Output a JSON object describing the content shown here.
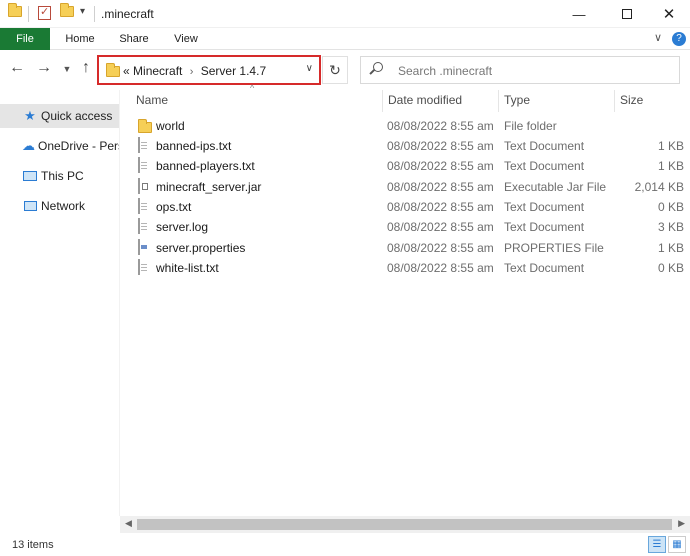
{
  "window": {
    "title": ".minecraft",
    "minimize_icon": "minimize-icon",
    "maximize_icon": "maximize-icon",
    "close_icon": "close-icon"
  },
  "ribbon": {
    "tabs": [
      "File",
      "Home",
      "Share",
      "View"
    ]
  },
  "navigation": {
    "address": {
      "prefix": "«",
      "segments": [
        "Minecraft",
        "Server 1.4.7"
      ]
    },
    "search_placeholder": "Search .minecraft"
  },
  "sidebar": {
    "items": [
      {
        "label": "Quick access",
        "icon": "star-icon"
      },
      {
        "label": "OneDrive - Pers",
        "icon": "onedrive-icon"
      },
      {
        "label": "This PC",
        "icon": "this-pc-icon"
      },
      {
        "label": "Network",
        "icon": "network-icon"
      }
    ]
  },
  "columns": [
    "Name",
    "Date modified",
    "Type",
    "Size"
  ],
  "files": [
    {
      "name": "world",
      "date": "08/08/2022 8:55 am",
      "type": "File folder",
      "size": "",
      "icon": "folder-icon"
    },
    {
      "name": "banned-ips.txt",
      "date": "08/08/2022 8:55 am",
      "type": "Text Document",
      "size": "1 KB",
      "icon": "text-file-icon"
    },
    {
      "name": "banned-players.txt",
      "date": "08/08/2022 8:55 am",
      "type": "Text Document",
      "size": "1 KB",
      "icon": "text-file-icon"
    },
    {
      "name": "minecraft_server.jar",
      "date": "08/08/2022 8:55 am",
      "type": "Executable Jar File",
      "size": "2,014 KB",
      "icon": "jar-file-icon"
    },
    {
      "name": "ops.txt",
      "date": "08/08/2022 8:55 am",
      "type": "Text Document",
      "size": "0 KB",
      "icon": "text-file-icon"
    },
    {
      "name": "server.log",
      "date": "08/08/2022 8:55 am",
      "type": "Text Document",
      "size": "3 KB",
      "icon": "text-file-icon"
    },
    {
      "name": "server.properties",
      "date": "08/08/2022 8:55 am",
      "type": "PROPERTIES File",
      "size": "1 KB",
      "icon": "properties-file-icon"
    },
    {
      "name": "white-list.txt",
      "date": "08/08/2022 8:55 am",
      "type": "Text Document",
      "size": "0 KB",
      "icon": "text-file-icon"
    }
  ],
  "status": {
    "item_count": "13 items"
  },
  "colors": {
    "file_tab": "#1a7a34",
    "address_highlight": "#d62a2a",
    "selected_sidebar": "#e5e5e5",
    "accent": "#2b7cd3"
  }
}
